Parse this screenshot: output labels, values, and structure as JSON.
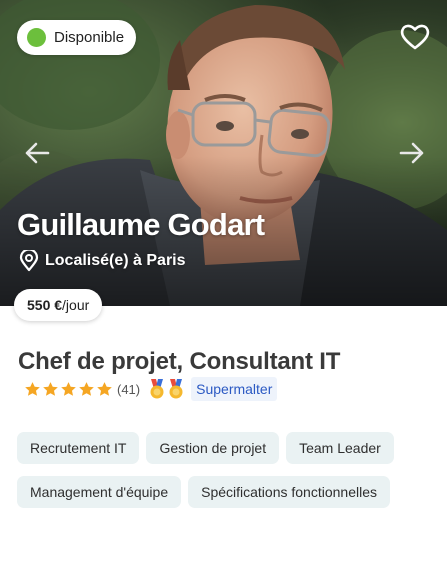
{
  "status": {
    "label": "Disponible",
    "color": "#6cbf3c"
  },
  "favorite": {
    "icon": "heart-icon"
  },
  "navigation": {
    "prev_icon": "arrow-left-icon",
    "next_icon": "arrow-right-icon"
  },
  "profile": {
    "name": "Guillaume Godart",
    "location": "Localisé(e) à Paris",
    "rate_amount": "550 €",
    "rate_unit": "/jour"
  },
  "job": {
    "title": "Chef de projet, Consultant IT"
  },
  "rating": {
    "stars": 5,
    "review_count": "(41)",
    "star_color": "#f5a623",
    "badge_label": "Supermalter"
  },
  "skills": [
    "Recrutement IT",
    "Gestion de projet",
    "Team Leader",
    "Management d'équipe",
    "Spécifications fonctionnelles"
  ]
}
